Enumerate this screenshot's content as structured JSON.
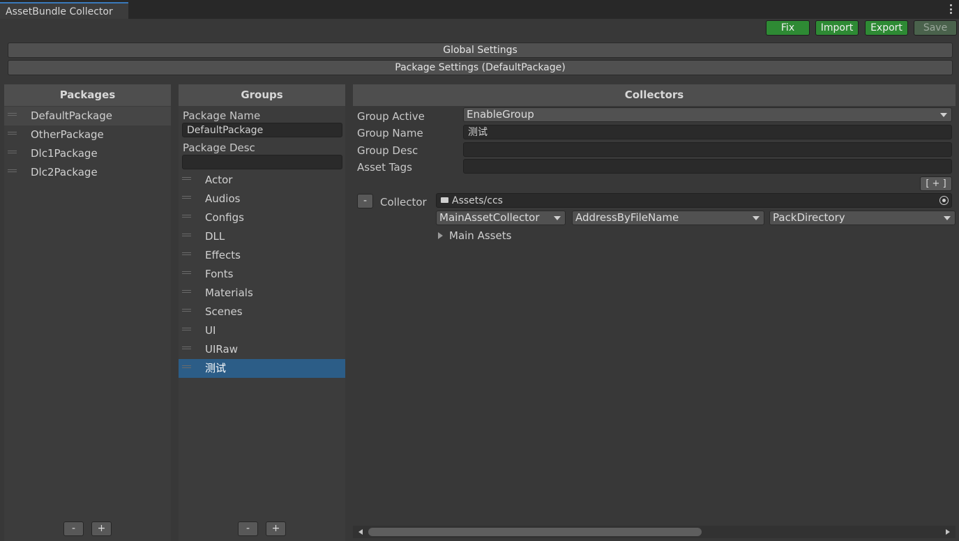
{
  "window": {
    "tab_title": "AssetBundle Collector"
  },
  "toolbar": {
    "fix": "Fix",
    "import": "Import",
    "export": "Export",
    "save": "Save"
  },
  "settings": {
    "global": "Global Settings",
    "package": "Package Settings (DefaultPackage)"
  },
  "packages": {
    "header": "Packages",
    "items": [
      "DefaultPackage",
      "OtherPackage",
      "Dlc1Package",
      "Dlc2Package"
    ],
    "selected": "DefaultPackage",
    "remove": "-",
    "add": "+"
  },
  "groups": {
    "header": "Groups",
    "package_name_label": "Package Name",
    "package_name_value": "DefaultPackage",
    "package_desc_label": "Package Desc",
    "package_desc_value": "",
    "items": [
      "Actor",
      "Audios",
      "Configs",
      "DLL",
      "Effects",
      "Fonts",
      "Materials",
      "Scenes",
      "UI",
      "UIRaw",
      "测试"
    ],
    "selected": "测试",
    "remove": "-",
    "add": "+"
  },
  "collectors": {
    "header": "Collectors",
    "group_active_label": "Group Active",
    "group_active_value": "EnableGroup",
    "group_name_label": "Group Name",
    "group_name_value": "测试",
    "group_desc_label": "Group Desc",
    "group_desc_value": "",
    "asset_tags_label": "Asset Tags",
    "asset_tags_value": "",
    "add_collector": "[ + ]",
    "remove_collector": "-",
    "collector_label": "Collector",
    "collector_path": "Assets/ccs",
    "collector_type": "MainAssetCollector",
    "address_rule": "AddressByFileName",
    "pack_rule": "PackDirectory",
    "main_assets": "Main Assets"
  },
  "colors": {
    "accent_green": "#2e8a34",
    "selection_blue": "#2c5d87",
    "tab_highlight": "#3a79bb"
  }
}
